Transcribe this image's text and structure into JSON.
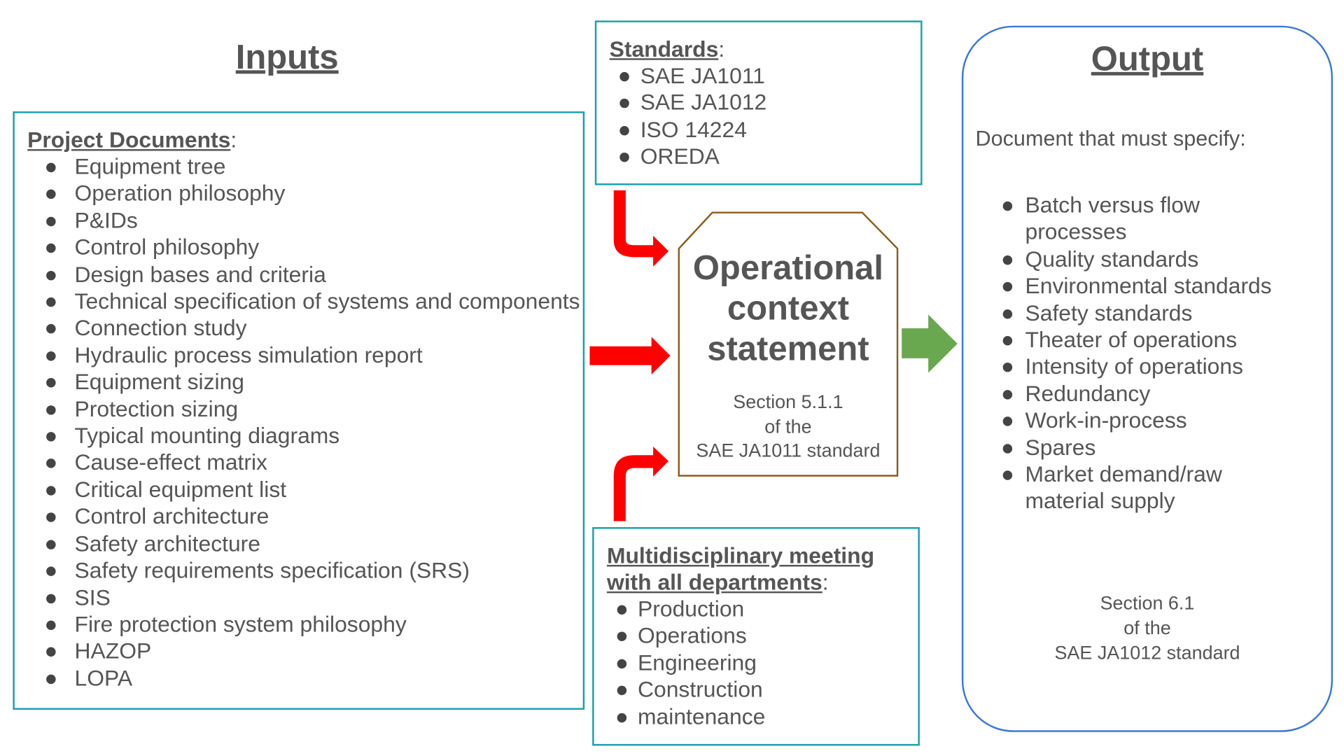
{
  "inputs": {
    "title": "Inputs",
    "heading": "Project Documents",
    "items": [
      "Equipment tree",
      "Operation philosophy",
      "P&IDs",
      "Control philosophy",
      "Design bases and criteria",
      "Technical specification of systems and components",
      "Connection study",
      "Hydraulic process simulation report",
      "Equipment sizing",
      "Protection sizing",
      "Typical mounting diagrams",
      "Cause-effect matrix",
      "Critical equipment list",
      "Control architecture",
      "Safety architecture",
      "Safety requirements specification (SRS)",
      "SIS",
      "Fire protection system philosophy",
      "HAZOP",
      "LOPA"
    ]
  },
  "standards": {
    "heading": "Standards",
    "items": [
      "SAE JA1011",
      "SAE JA1012",
      "ISO 14224",
      "OREDA"
    ]
  },
  "center": {
    "title_lines": [
      "Operational",
      "context",
      "statement"
    ],
    "ref_lines": [
      "Section 5.1.1",
      "of the",
      "SAE JA1011 standard"
    ]
  },
  "meeting": {
    "heading_1": "Multidisciplinary meeting",
    "heading_2": "with all departments",
    "items": [
      "Production",
      "Operations",
      "Engineering",
      "Construction",
      "maintenance"
    ]
  },
  "output": {
    "title": "Output",
    "intro": "Document that must specify:",
    "items": [
      "Batch versus flow processes",
      "Quality standards",
      "Environmental standards",
      "Safety standards",
      "Theater of operations",
      "Intensity of operations",
      "Redundancy",
      "Work-in-process",
      "Spares",
      "Market demand/raw material supply"
    ],
    "ref_lines": [
      "Section 6.1",
      "of the",
      "SAE JA1012 standard"
    ]
  },
  "colors": {
    "input_arrows": "#ff0000",
    "output_arrow": "#6aa84f",
    "box_border": "#1aa0ad",
    "output_border": "#3c78d8",
    "center_border": "#8b5e1a"
  }
}
